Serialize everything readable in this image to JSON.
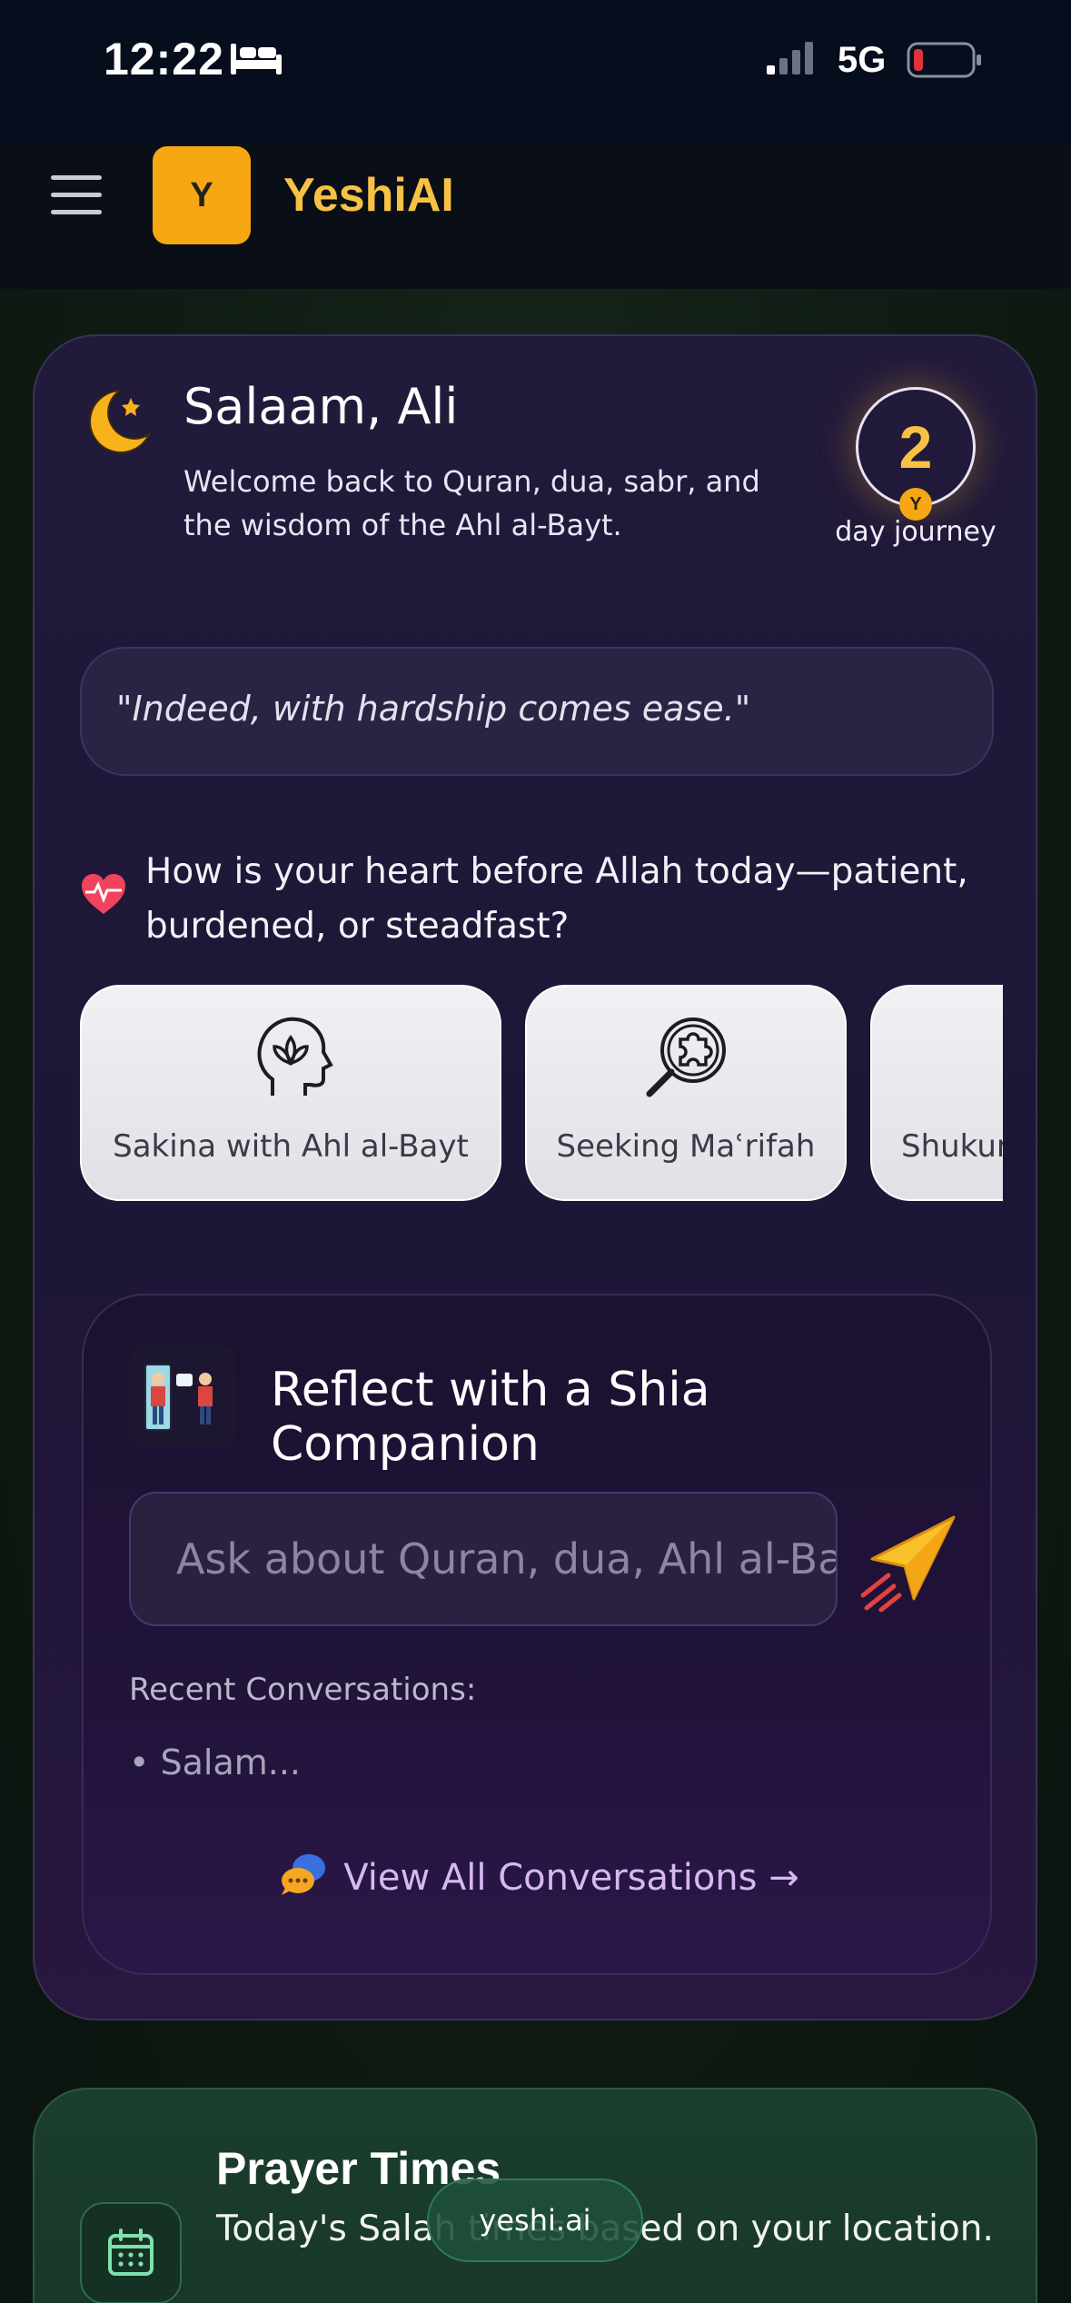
{
  "status_bar": {
    "time": "12:22",
    "network": "5G",
    "icons": [
      "bed-icon",
      "signal-icon",
      "battery-icon"
    ]
  },
  "header": {
    "logo_letter": "Y",
    "brand": "YeshiAI",
    "menu_icon": "hamburger-icon"
  },
  "greeting": {
    "title": "Salaam, Ali",
    "subtitle": "Welcome back to Quran, dua, sabr, and the wisdom of the Ahl al-Bayt.",
    "streak_count": "2",
    "streak_badge": "Y",
    "streak_label": "day journey"
  },
  "quote": "\"Indeed, with hardship comes ease.\"",
  "mood": {
    "question": "How is your heart before Allah today—patient, burdened, or steadfast?",
    "options": [
      {
        "label": "Sakina with Ahl al-Bayt",
        "icon": "head-lotus-icon"
      },
      {
        "label": "Seeking Maʿrifah",
        "icon": "puzzle-magnifier-icon"
      },
      {
        "label": "Shukur",
        "icon": ""
      }
    ]
  },
  "companion": {
    "title": "Reflect with a Shia Companion",
    "input_placeholder": "Ask about Quran, dua, Ahl al-Bayt...",
    "recent_label": "Recent Conversations:",
    "recent_items": [
      "• Salam..."
    ],
    "view_all": "View All Conversations →"
  },
  "prayer": {
    "title": "Prayer Times",
    "subtitle": "Today's Salah times based on your location."
  },
  "browser": {
    "url": "yeshi.ai"
  },
  "colors": {
    "accent": "#f6a712",
    "brand_text": "#f7c244",
    "card_purple": "#221a3b",
    "link_purple": "#d8b7f5",
    "prayer_green": "#1b3e2e"
  }
}
